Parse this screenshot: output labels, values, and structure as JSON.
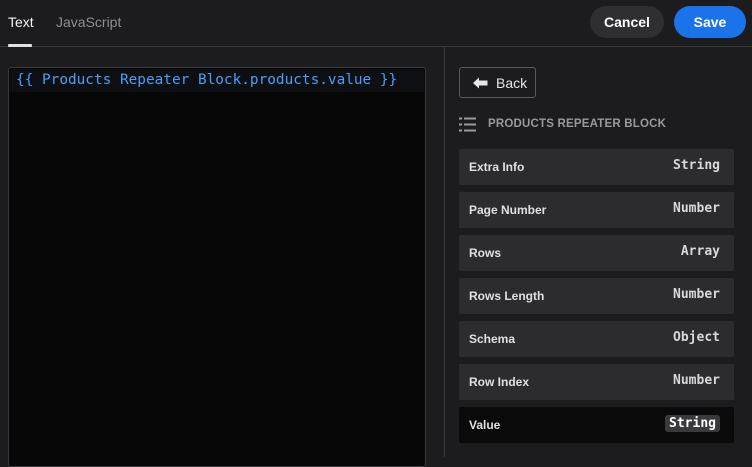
{
  "tabs": [
    {
      "label": "Text",
      "active": true
    },
    {
      "label": "JavaScript",
      "active": false
    }
  ],
  "actions": {
    "cancel_label": "Cancel",
    "save_label": "Save"
  },
  "editor": {
    "code": "{{ Products Repeater Block.products.value }}"
  },
  "panel": {
    "back_label": "Back",
    "section_title": "PRODUCTS REPEATER BLOCK",
    "rows": [
      {
        "name": "Extra Info",
        "type": "String"
      },
      {
        "name": "Page Number",
        "type": "Number"
      },
      {
        "name": "Rows",
        "type": "Array"
      },
      {
        "name": "Rows Length",
        "type": "Number"
      },
      {
        "name": "Schema",
        "type": "Object"
      },
      {
        "name": "Row Index",
        "type": "Number"
      },
      {
        "name": "Value",
        "type": "String",
        "selected": true
      }
    ]
  },
  "colors": {
    "background": "#1c1c1e",
    "accent": "#1a73e8",
    "code": "#4a9ff5",
    "row": "#2c2c2e",
    "row_selected": "#0a0a0b"
  }
}
